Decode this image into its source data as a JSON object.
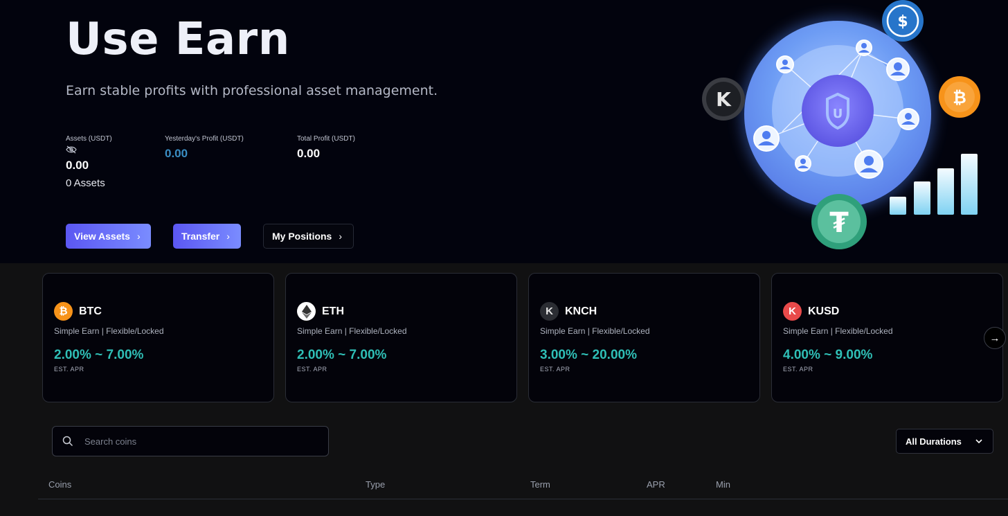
{
  "hero": {
    "title": "Use Earn",
    "subtitle": "Earn stable profits with professional asset management."
  },
  "stats": {
    "assets_label": "Assets (USDT)",
    "assets_value": "0.00",
    "assets_count": "0 Assets",
    "yesterday_label": "Yesterday's Profit (USDT)",
    "yesterday_value": "0.00",
    "total_label": "Total Profit (USDT)",
    "total_value": "0.00"
  },
  "buttons": {
    "view_assets": "View Assets",
    "transfer": "Transfer",
    "my_positions": "My Positions"
  },
  "cards": [
    {
      "name": "BTC",
      "type": "Simple Earn | Flexible/Locked",
      "apr": "2.00% ~ 7.00%",
      "apr_label": "EST. APR",
      "icon": "bitcoin-icon",
      "color": "#f7931a",
      "glyph": "₿"
    },
    {
      "name": "ETH",
      "type": "Simple Earn | Flexible/Locked",
      "apr": "2.00% ~ 7.00%",
      "apr_label": "EST. APR",
      "icon": "ethereum-icon",
      "color": "#ffffff",
      "glyph": "♦"
    },
    {
      "name": "KNCH",
      "type": "Simple Earn | Flexible/Locked",
      "apr": "3.00% ~ 20.00%",
      "apr_label": "EST. APR",
      "icon": "knch-icon",
      "color": "#2b2d33",
      "glyph": "K"
    },
    {
      "name": "KUSD",
      "type": "Simple Earn | Flexible/Locked",
      "apr": "4.00% ~ 9.00%",
      "apr_label": "EST. APR",
      "icon": "kusd-icon",
      "color": "#e84a4a",
      "glyph": "K"
    }
  ],
  "search": {
    "placeholder": "Search coins"
  },
  "filter": {
    "label": "All Durations"
  },
  "table": {
    "columns": [
      "Coins",
      "Type",
      "Term",
      "APR",
      "Min"
    ]
  },
  "colors": {
    "accent": "#5b57f2",
    "apr": "#2fbfb6",
    "profit": "#3a8ec4"
  }
}
